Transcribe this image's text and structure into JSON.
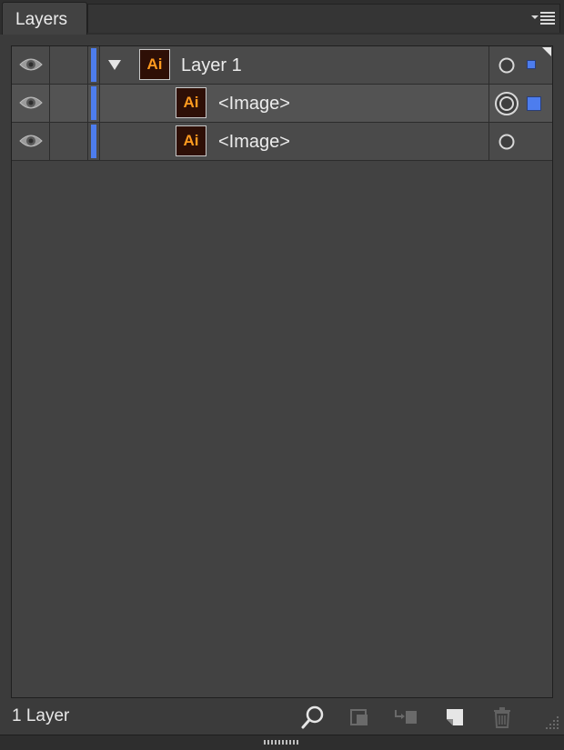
{
  "panel": {
    "tab_label": "Layers",
    "menu_icon": "panel-menu-icon"
  },
  "layers": [
    {
      "name": "Layer 1",
      "thumb_label": "Ai",
      "visible": true,
      "expanded": true,
      "level": 0,
      "target": "circle",
      "selection": "small-square"
    },
    {
      "name": "<Image>",
      "thumb_label": "Ai",
      "visible": true,
      "level": 1,
      "target": "double-circle",
      "selection": "large-square"
    },
    {
      "name": "<Image>",
      "thumb_label": "Ai",
      "visible": true,
      "level": 1,
      "target": "circle",
      "selection": "none"
    }
  ],
  "footer": {
    "layer_count": "1 Layer",
    "icons": [
      "locate-object-icon",
      "make-clipping-mask-icon",
      "create-sublayer-icon",
      "create-new-layer-icon",
      "delete-layer-icon"
    ]
  },
  "colors": {
    "layer_color": "#4d7dee",
    "panel_bg": "#424242",
    "thumb_text": "#ff9a1f"
  }
}
